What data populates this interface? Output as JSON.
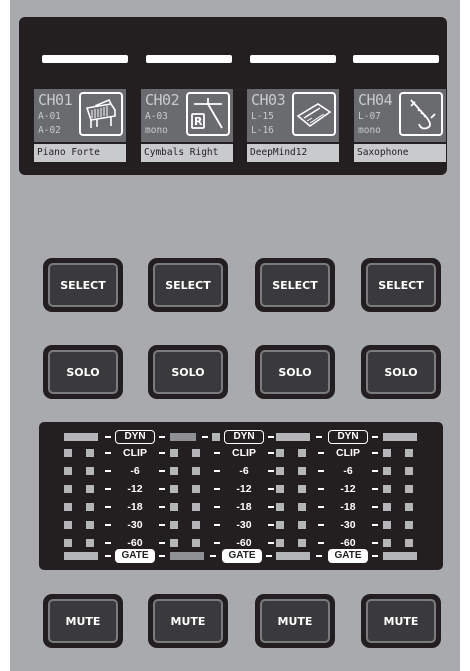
{
  "channels": [
    {
      "name": "CH01",
      "in1": "A-01",
      "in2": "A-02",
      "label": "Piano Forte",
      "icon": "piano-icon"
    },
    {
      "name": "CH02",
      "in1": "A-03",
      "in2": "mono",
      "label": "Cymbals Right",
      "icon": "cymbal-right-icon"
    },
    {
      "name": "CH03",
      "in1": "L-15",
      "in2": "L-16",
      "label": "DeepMind12",
      "icon": "synth-keyboard-icon"
    },
    {
      "name": "CH04",
      "in1": "L-07",
      "in2": "mono",
      "label": "Saxophone",
      "icon": "saxophone-icon"
    }
  ],
  "buttons": {
    "select": "SELECT",
    "solo": "SOLO",
    "mute": "MUTE"
  },
  "meters": {
    "dyn": "DYN",
    "gate": "GATE",
    "levels": [
      "CLIP",
      "-6",
      "-12",
      "-18",
      "-30",
      "-60"
    ]
  },
  "colors": {
    "panel": "#a9aaad",
    "screen": "#231f20",
    "button": "#231f20"
  }
}
